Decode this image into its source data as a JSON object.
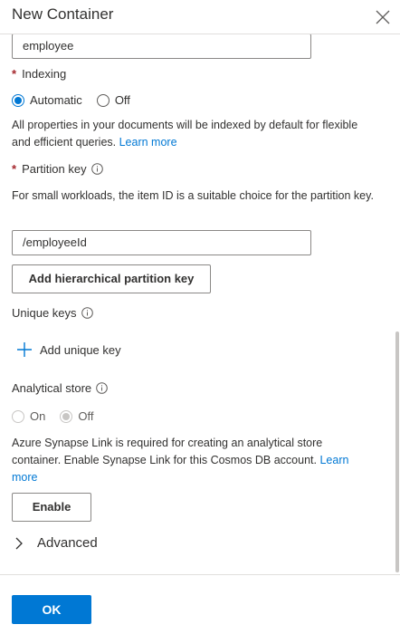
{
  "panel": {
    "title": "New Container"
  },
  "container_id": {
    "value": "employee"
  },
  "indexing": {
    "label": "Indexing",
    "options": [
      "Automatic",
      "Off"
    ],
    "selected": "Automatic",
    "description": "All properties in your documents will be indexed by default for flexible and efficient queries.",
    "link": "Learn more"
  },
  "partition_key": {
    "label": "Partition key",
    "description": "For small workloads, the item ID is a suitable choice for the partition key.",
    "value": "/employeeId",
    "hierarchical_button": "Add hierarchical partition key"
  },
  "unique_keys": {
    "label": "Unique keys",
    "add_label": "Add unique key"
  },
  "analytical_store": {
    "label": "Analytical store",
    "options": [
      "On",
      "Off"
    ],
    "selected": "Off",
    "description": "Azure Synapse Link is required for creating an analytical store container. Enable Synapse Link for this Cosmos DB account.",
    "link": "Learn more",
    "enable_button": "Enable"
  },
  "advanced": {
    "label": "Advanced"
  },
  "footer": {
    "ok_label": "OK"
  },
  "colors": {
    "accent": "#0078d4",
    "required": "#a4262c",
    "border": "#8a8886"
  }
}
